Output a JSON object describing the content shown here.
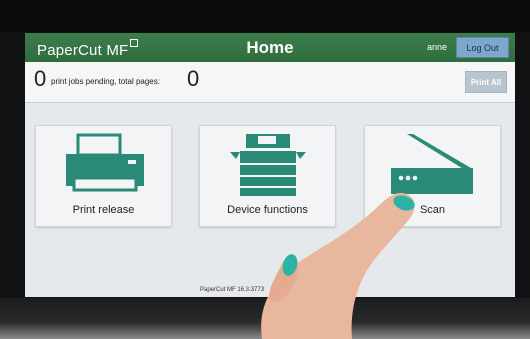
{
  "header": {
    "brand": "PaperCut MF",
    "title": "Home",
    "username": "anne",
    "logout_label": "Log Out"
  },
  "status": {
    "jobs_pending": "0",
    "text": "print jobs pending, total pages:",
    "total_pages": "0",
    "print_all_label": "Print All"
  },
  "tiles": [
    {
      "label": "Print release",
      "icon": "printer-icon"
    },
    {
      "label": "Device functions",
      "icon": "copier-icon"
    },
    {
      "label": "Scan",
      "icon": "scanner-icon"
    }
  ],
  "footer": {
    "version_text": "PaperCut MF 16.3.3773"
  },
  "colors": {
    "header_green": "#2f6d3e",
    "icon_teal": "#2a8a78",
    "logout_blue": "#7fa6cc"
  }
}
